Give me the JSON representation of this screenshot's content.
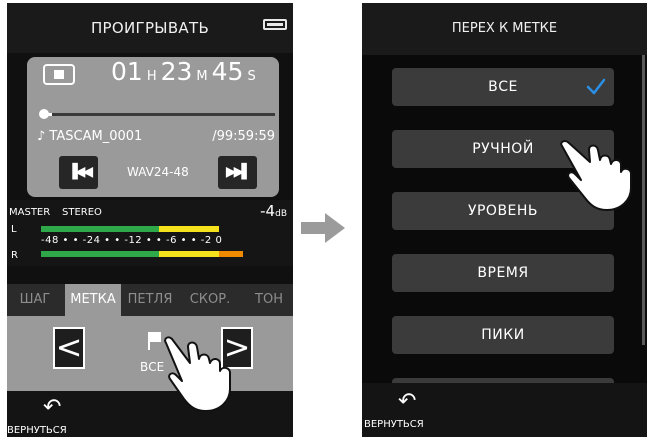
{
  "left_screen": {
    "title": "ПРОИГРЫВАТЬ",
    "time": {
      "h": "01",
      "h_unit": "H",
      "m": "23",
      "m_unit": "M",
      "s": "45",
      "s_unit": "S"
    },
    "progress_fraction": 0.04,
    "file_name": "♪ TASCAM_0001",
    "total_time": "/99:59:59",
    "format": "WAV24-48",
    "prev_icon": "skip-back-icon",
    "next_icon": "skip-forward-icon",
    "meter": {
      "master_label": "MASTER",
      "mode_label": "STEREO",
      "level_value": "-4",
      "level_unit": "dB",
      "left_channel": "L",
      "right_channel": "R",
      "scale": "-48 • • -24 • • -12 • • -6 • • -2 0",
      "colors": {
        "green": "#2fa84a",
        "yellow": "#f5e21c",
        "orange": "#f08a00"
      }
    },
    "tabs": [
      {
        "label": "ШАГ",
        "active": false
      },
      {
        "label": "МЕТКА",
        "active": true
      },
      {
        "label": "ПЕТЛЯ",
        "active": false
      },
      {
        "label": "СКОР.",
        "active": false
      },
      {
        "label": "ТОН",
        "active": false
      }
    ],
    "mark_prev": "<",
    "mark_next": ">",
    "mark_selection": "ВСЕ",
    "back_label": "ВЕРНУТЬСЯ"
  },
  "right_screen": {
    "title": "ПЕРЕХ К МЕТКЕ",
    "options": [
      {
        "label": "ВСЕ",
        "checked": true
      },
      {
        "label": "РУЧНОЙ",
        "checked": false
      },
      {
        "label": "УРОВЕНЬ",
        "checked": false
      },
      {
        "label": "ВРЕМЯ",
        "checked": false
      },
      {
        "label": "ПИКИ",
        "checked": false
      }
    ],
    "back_label": "ВЕРНУТЬСЯ",
    "check_color": "#2b8fe6"
  }
}
